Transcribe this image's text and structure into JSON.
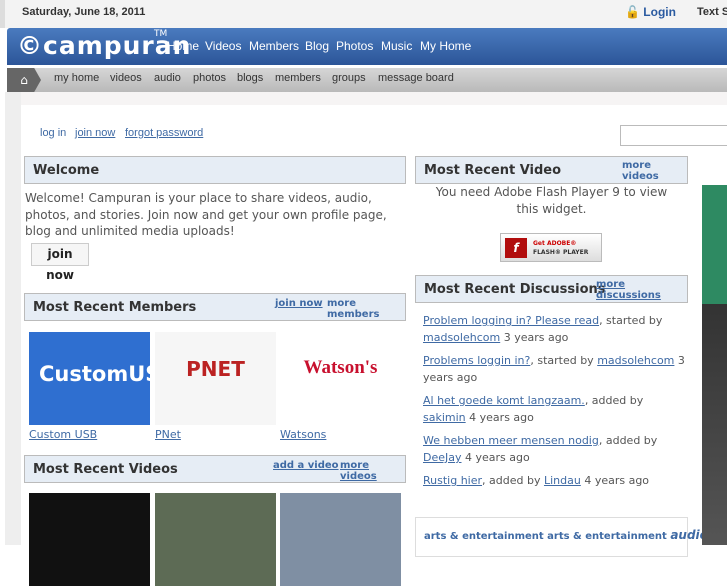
{
  "top": {
    "date": "Saturday, June 18, 2011",
    "login": "Login",
    "text_size": "Text S"
  },
  "brand": {
    "logo": "©campuran",
    "tm": "TM"
  },
  "main_nav": [
    "Home",
    "Videos",
    "Members",
    "Blog",
    "Photos",
    "Music",
    "My Home"
  ],
  "sub_nav": [
    "my home",
    "videos",
    "audio",
    "photos",
    "blogs",
    "members",
    "groups",
    "message board"
  ],
  "account_links": [
    "log in",
    "join now",
    "forgot password"
  ],
  "welcome": {
    "title": "Welcome",
    "text": "Welcome! Campuran is your place to share videos, audio, photos, and stories. Join now and get your own profile page, blog and unlimited media uploads!",
    "button": "join now"
  },
  "members": {
    "title": "Most Recent Members",
    "join": "join now",
    "more": "more members",
    "items": [
      {
        "name": "Custom USB",
        "logo": "CustomUSB",
        "color": "#2f6fd0"
      },
      {
        "name": "PNet",
        "logo": "PNET",
        "color": "#f6f6f6"
      },
      {
        "name": "Watsons",
        "logo": "Watson's",
        "color": "#fff"
      }
    ]
  },
  "videos": {
    "title": "Most Recent Videos",
    "add": "add a video",
    "more": "more videos"
  },
  "recent_video": {
    "title": "Most Recent Video",
    "more": "more videos",
    "text": "You need Adobe Flash Player 9 to view this widget.",
    "flash_1": "Get ADOBE®",
    "flash_2": "FLASH® PLAYER"
  },
  "discussions": {
    "title": "Most Recent Discussions",
    "more": "more discussions",
    "items": [
      {
        "title": "Problem logging in? Please read",
        "verb": ", started by ",
        "user": "madsolehcom",
        "age": " 3 years ago"
      },
      {
        "title": "Problems loggin in?",
        "verb": ", started by ",
        "user": "madsolehcom",
        "age": " 3 years ago"
      },
      {
        "title": "Al het goede komt langzaam.",
        "verb": ", added by ",
        "user": "sakimin",
        "age": " 4 years ago"
      },
      {
        "title": "We hebben meer mensen nodig",
        "verb": ", added by ",
        "user": "DeeJay",
        "age": " 4 years ago"
      },
      {
        "title": "Rustig hier",
        "verb": ", added by ",
        "user": "Lindau",
        "age": " 4 years ago"
      }
    ]
  },
  "tags": {
    "t1": "arts & entertainment arts & entertainment",
    "t2": "audio file"
  }
}
